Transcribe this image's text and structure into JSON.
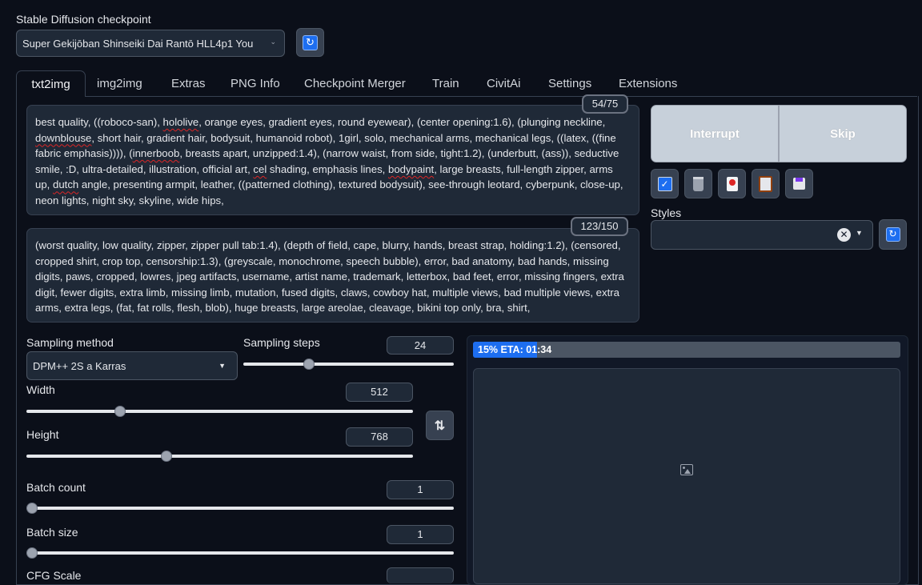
{
  "checkpoint": {
    "label": "Stable Diffusion checkpoint",
    "value": "Super Gekijōban Shinseiki Dai Rantō HLL4p1 You",
    "refresh_icon": "refresh-icon"
  },
  "tabs": [
    "txt2img",
    "img2img",
    "Extras",
    "PNG Info",
    "Checkpoint Merger",
    "Train",
    "CivitAi",
    "Settings",
    "Extensions"
  ],
  "positive_prompt": {
    "counter": "54/75",
    "lines": [
      [
        {
          "t": "best quality, ((roboco-san), "
        },
        {
          "t": "hololive",
          "s": 1
        },
        {
          "t": ", orange eyes, gradient eyes, round eyewear), (center opening:1.6), (plunging neckline,"
        }
      ],
      [
        {
          "t": "downblouse",
          "s": 1
        },
        {
          "t": ", short hair, gradient hair, bodysuit, humanoid robot), 1girl, solo, mechanical arms, mechanical legs, ((latex, ((fine"
        }
      ],
      [
        {
          "t": "fabric emphasis)))), ("
        },
        {
          "t": "innerboob",
          "s": 1
        },
        {
          "t": ", breasts apart, unzipped:1.4), (narrow waist, from side, tight:1.2), (underbutt, (ass)), seductive"
        }
      ],
      [
        {
          "t": "smile, :D, ultra-detailed, illustration, official art, "
        },
        {
          "t": "cel",
          "s": 1
        },
        {
          "t": " shading, emphasis lines, "
        },
        {
          "t": "bodypaint",
          "s": 1
        },
        {
          "t": ", large breasts, full-length zipper, arms"
        }
      ],
      [
        {
          "t": "up, "
        },
        {
          "t": "dutch",
          "s": 1
        },
        {
          "t": " angle, presenting armpit, leather, ((patterned clothing), textured bodysuit), see-through leotard, cyberpunk, close-up,"
        }
      ],
      [
        {
          "t": "neon lights, night sky, skyline, wide hips,"
        }
      ]
    ]
  },
  "negative_prompt": {
    "counter": "123/150",
    "lines": [
      "(worst quality, low quality, zipper, zipper pull tab:1.4), (depth of field, cape, blurry, hands, breast strap, holding:1.2), (censored,",
      "cropped shirt, crop top, censorship:1.3), (greyscale, monochrome, speech bubble), error, bad anatomy, bad hands, missing",
      "digits, paws, cropped, lowres, jpeg artifacts, username, artist name, trademark, letterbox, bad feet, error, missing fingers, extra",
      "digit, fewer digits, extra limb, missing limb, mutation, fused digits, claws, cowboy hat, multiple views, bad multiple views, extra",
      "arms, extra legs, (fat, fat rolls, flesh, blob), huge breasts, large areolae, cleavage, bikini top only, bra, shirt,"
    ]
  },
  "actions": {
    "interrupt": "Interrupt",
    "skip": "Skip"
  },
  "toolbar_icons": [
    "checkbox-icon",
    "trash-icon",
    "red-card-icon",
    "clipboard-icon",
    "save-icon"
  ],
  "styles": {
    "label": "Styles",
    "value": ""
  },
  "sampling": {
    "method_label": "Sampling method",
    "method_value": "DPM++ 2S a Karras",
    "steps_label": "Sampling steps",
    "steps_value": "24",
    "steps_fraction": 0.3
  },
  "width": {
    "label": "Width",
    "value": "512",
    "fraction": 0.234
  },
  "height": {
    "label": "Height",
    "value": "768",
    "fraction": 0.359
  },
  "batch_count": {
    "label": "Batch count",
    "value": "1",
    "fraction": 0
  },
  "batch_size": {
    "label": "Batch size",
    "value": "1",
    "fraction": 0
  },
  "cfg": {
    "label": "CFG Scale"
  },
  "progress": {
    "text": "15% ETA: 01:34",
    "fraction": 0.15
  },
  "colors": {
    "accent": "#1d6ef0",
    "button": "#c7d0da"
  }
}
